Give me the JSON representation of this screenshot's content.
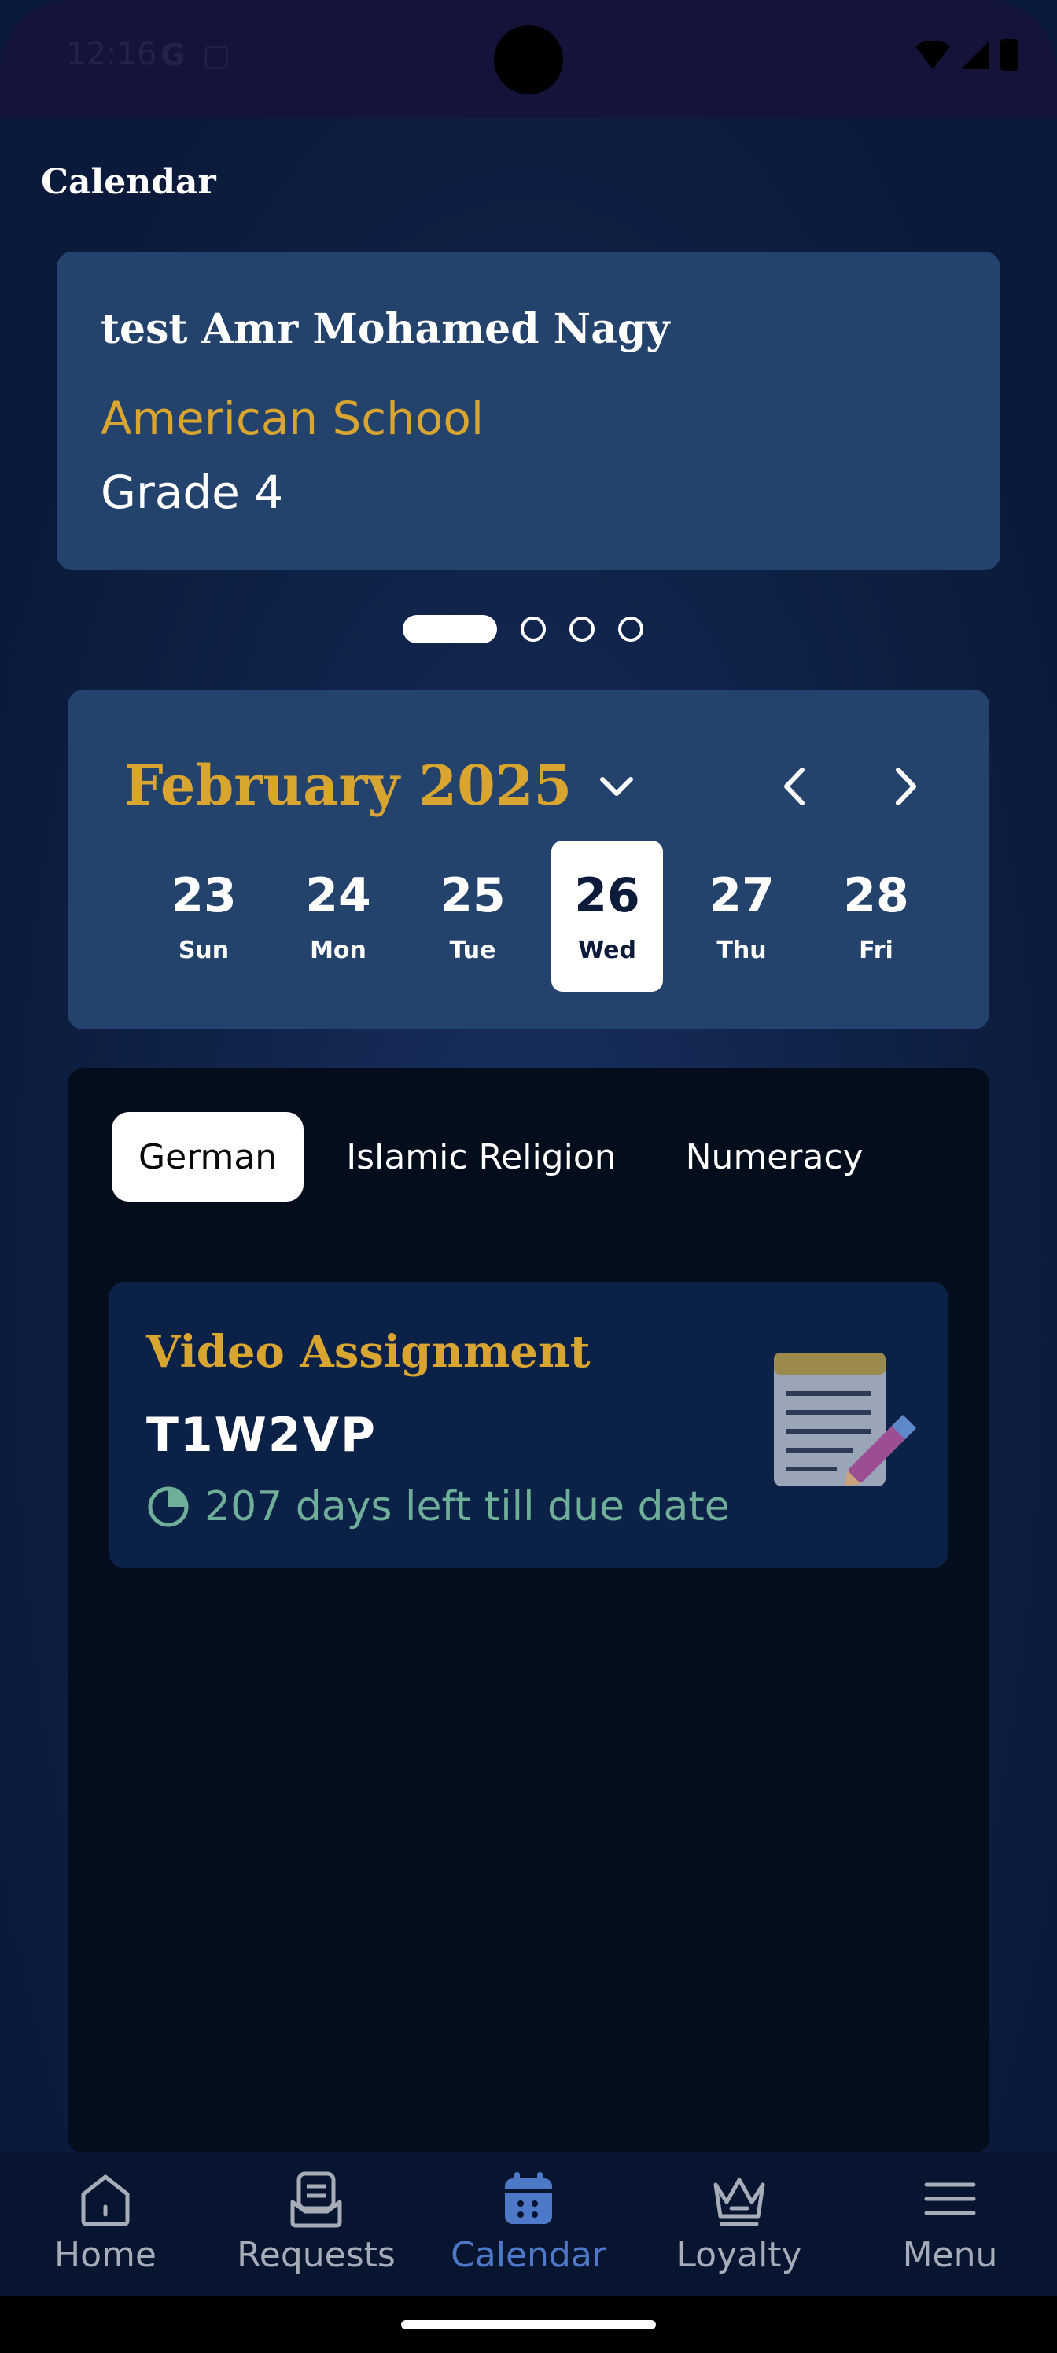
{
  "status_bar": {
    "time": "12:16"
  },
  "header": {
    "title": "Calendar"
  },
  "student": {
    "name": "test Amr Mohamed Nagy",
    "school": "American School",
    "grade": "Grade 4"
  },
  "pager": {
    "total": 4,
    "active_index": 0
  },
  "calendar": {
    "month": "February 2025",
    "days": [
      {
        "num": "23",
        "weekday": "Sun"
      },
      {
        "num": "24",
        "weekday": "Mon"
      },
      {
        "num": "25",
        "weekday": "Tue"
      },
      {
        "num": "26",
        "weekday": "Wed"
      },
      {
        "num": "27",
        "weekday": "Thu"
      },
      {
        "num": "28",
        "weekday": "Fri"
      }
    ],
    "selected_day": "26"
  },
  "subjects": {
    "tabs": [
      "German",
      "Islamic Religion",
      "Numeracy"
    ],
    "active_tab": "German"
  },
  "assignment": {
    "type": "Video Assignment",
    "code": "T1W2VP",
    "due_text": "207 days left till due date",
    "icon": "notepad-icon"
  },
  "nav": {
    "items": [
      {
        "label": "Home",
        "icon": "home-icon"
      },
      {
        "label": "Requests",
        "icon": "requests-icon"
      },
      {
        "label": "Calendar",
        "icon": "calendar-icon"
      },
      {
        "label": "Loyalty",
        "icon": "crown-icon"
      },
      {
        "label": "Menu",
        "icon": "menu-icon"
      }
    ],
    "active": "Calendar"
  },
  "colors": {
    "accent_gold": "#d9a531",
    "active_nav": "#4e79c8",
    "due_green": "#6fae98",
    "card_bg": "#23426c"
  }
}
